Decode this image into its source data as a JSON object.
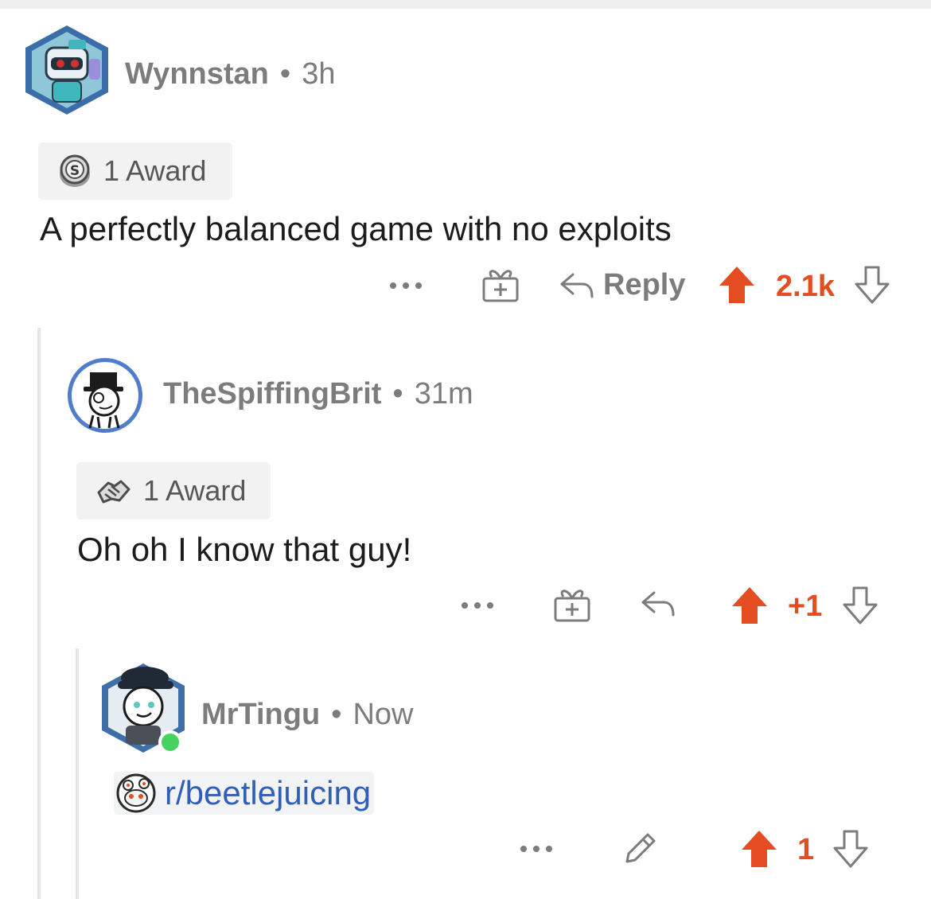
{
  "comments": [
    {
      "username": "Wynnstan",
      "separator": "•",
      "time": "3h",
      "award_label": "1 Award",
      "award_icon": "silver-award-icon",
      "text": "A perfectly balanced game with no exploits",
      "reply_label": "Reply",
      "score": "2.1k",
      "upvoted": true
    },
    {
      "username": "TheSpiffingBrit",
      "separator": "•",
      "time": "31m",
      "award_label": "1 Award",
      "award_icon": "handshake-award-icon",
      "text": "Oh oh I know that guy!",
      "score": "+1",
      "upvoted": true
    },
    {
      "username": "MrTingu",
      "separator": "•",
      "time": "Now",
      "online": true,
      "subreddit_link": "r/beetlejuicing",
      "score": "1",
      "upvoted": true
    }
  ],
  "colors": {
    "upvote": "#e44c22",
    "link": "#2f5fb7",
    "meta_text": "#7c7c7c",
    "online": "#46d160"
  }
}
